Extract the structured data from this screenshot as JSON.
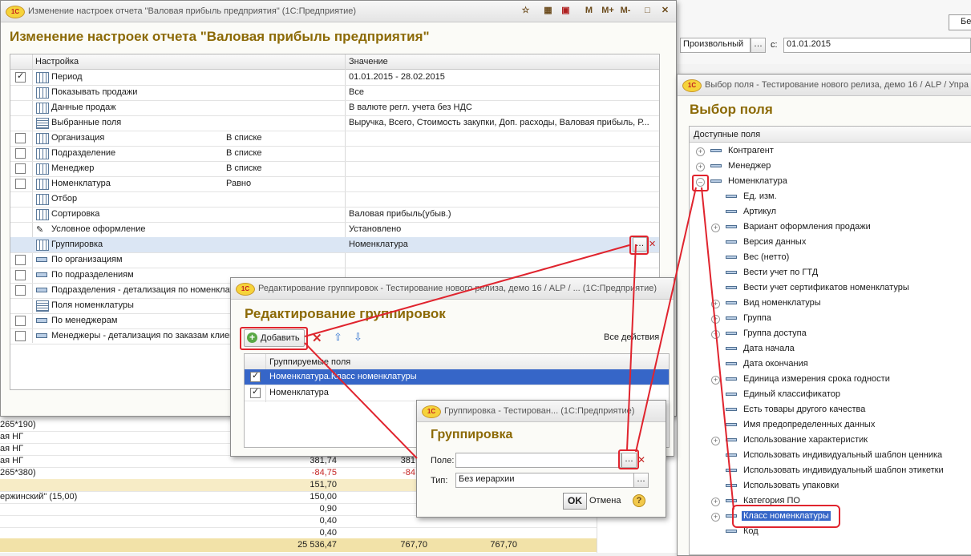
{
  "bg": {
    "period_type": "Произвольный",
    "date_from_label": "с:",
    "date_from": "01.01.2015",
    "corner_btn": "Бе",
    "rows": [
      {
        "a": "265*190)",
        "b": "",
        "c": ""
      },
      {
        "a": "ая НГ",
        "b": "",
        "c": ""
      },
      {
        "a": "ая НГ",
        "b": "",
        "c": ""
      },
      {
        "a": "ая НГ",
        "b": "381,74",
        "c": "381"
      },
      {
        "a": "265*380)",
        "b": "-84,75",
        "c": "-84"
      },
      {
        "a": "",
        "b": "151,70",
        "c": ""
      },
      {
        "a": "ержинский\" (15,00)",
        "b": "150,00",
        "c": ""
      },
      {
        "a": "",
        "b": "0,90",
        "c": ""
      },
      {
        "a": "",
        "b": "0,40",
        "c": ""
      },
      {
        "a": "",
        "b": "0,40",
        "c": ""
      }
    ],
    "totals": [
      "25 536,47",
      "767,70",
      "767,70"
    ]
  },
  "settings_win": {
    "title": "Изменение настроек отчета \"Валовая прибыль предприятия\" (1С:Предприятие)",
    "heading": "Изменение настроек отчета \"Валовая прибыль предприятия\"",
    "col_setting": "Настройка",
    "col_value": "Значение",
    "rows": [
      {
        "name": "Период",
        "value": "01.01.2015 - 28.02.2015",
        "kind": "",
        "cb": true,
        "icon": "tbl"
      },
      {
        "name": "Показывать продажи",
        "value": "Все",
        "kind": "",
        "cb": null,
        "icon": "tbl"
      },
      {
        "name": "Данные продаж",
        "value": "В валюте регл. учета без НДС",
        "kind": "",
        "cb": null,
        "icon": "tbl"
      },
      {
        "name": "Выбранные поля",
        "value": "Выручка, Всего, Стоимость закупки, Доп. расходы, Валовая прибыль, Р...",
        "kind": "",
        "cb": null,
        "icon": "list"
      },
      {
        "name": "Организация",
        "value": "",
        "kind": "В списке",
        "cb": false,
        "icon": "tbl"
      },
      {
        "name": "Подразделение",
        "value": "",
        "kind": "В списке",
        "cb": false,
        "icon": "tbl"
      },
      {
        "name": "Менеджер",
        "value": "",
        "kind": "В списке",
        "cb": false,
        "icon": "tbl"
      },
      {
        "name": "Номенклатура",
        "value": "",
        "kind": "Равно",
        "cb": false,
        "icon": "tbl"
      },
      {
        "name": "Отбор",
        "value": "",
        "kind": "",
        "cb": null,
        "icon": "tbl"
      },
      {
        "name": "Сортировка",
        "value": "Валовая прибыль(убыв.)",
        "kind": "",
        "cb": null,
        "icon": "tbl"
      },
      {
        "name": "Условное оформление",
        "value": "Установлено",
        "kind": "",
        "cb": null,
        "icon": "pen"
      },
      {
        "name": "Группировка",
        "value": "Номенклатура",
        "kind": "",
        "cb": null,
        "icon": "tbl",
        "selected": true
      },
      {
        "name": "По организациям",
        "value": "",
        "kind": "",
        "cb": false,
        "icon": "dash"
      },
      {
        "name": "По подразделениям",
        "value": "",
        "kind": "",
        "cb": false,
        "icon": "dash"
      },
      {
        "name": "Подразделения - детализация по номенклатуре",
        "value": "",
        "kind": "",
        "cb": false,
        "icon": "dash"
      },
      {
        "name": "Поля номенклатуры",
        "value": "",
        "kind": "",
        "cb": null,
        "icon": "list"
      },
      {
        "name": "По менеджерам",
        "value": "",
        "kind": "",
        "cb": false,
        "icon": "dash"
      },
      {
        "name": "Менеджеры - детализация по заказам клиентов",
        "value": "",
        "kind": "",
        "cb": false,
        "icon": "dash"
      }
    ],
    "tb_icons": [
      "star-icon",
      "calc-icon",
      "calendar-icon"
    ],
    "tb_text": [
      "M",
      "M+",
      "M-"
    ]
  },
  "group_edit_win": {
    "title": "Редактирование группировок - Тестирование нового релиза, демо 16 / ALP / ...  (1С:Предприятие)",
    "heading": "Редактирование группировок",
    "add_btn": "Добавить",
    "all_actions": "Все действия",
    "col": "Группируемые поля",
    "rows": [
      {
        "name": "Номенклатура.Класс номенклатуры",
        "checked": true,
        "selected": true
      },
      {
        "name": "Номенклатура",
        "checked": true,
        "selected": false
      }
    ]
  },
  "grouping_win": {
    "title": "Группировка - Тестирован...  (1С:Предприятие)",
    "heading": "Группировка",
    "field_label": "Поле:",
    "field_value": "",
    "type_label": "Тип:",
    "type_value": "Без иерархии",
    "ok": "OK",
    "cancel": "Отмена",
    "help": "?"
  },
  "field_win": {
    "title": "Выбор поля - Тестирование нового релиза, демо 16 / ALP / Упра",
    "heading": "Выбор поля",
    "col": "Доступные поля",
    "nodes": [
      {
        "name": "Контрагент",
        "level": 0,
        "exp": "+"
      },
      {
        "name": "Менеджер",
        "level": 0,
        "exp": "+"
      },
      {
        "name": "Номенклатура",
        "level": 0,
        "exp": "-"
      },
      {
        "name": "Ед. изм.",
        "level": 1,
        "exp": ""
      },
      {
        "name": "Артикул",
        "level": 1,
        "exp": ""
      },
      {
        "name": "Вариант оформления продажи",
        "level": 1,
        "exp": "+"
      },
      {
        "name": "Версия данных",
        "level": 1,
        "exp": ""
      },
      {
        "name": "Вес (нетто)",
        "level": 1,
        "exp": ""
      },
      {
        "name": "Вести учет по ГТД",
        "level": 1,
        "exp": ""
      },
      {
        "name": "Вести учет сертификатов номенклатуры",
        "level": 1,
        "exp": ""
      },
      {
        "name": "Вид номенклатуры",
        "level": 1,
        "exp": "+"
      },
      {
        "name": "Группа",
        "level": 1,
        "exp": "+"
      },
      {
        "name": "Группа доступа",
        "level": 1,
        "exp": "+"
      },
      {
        "name": "Дата начала",
        "level": 1,
        "exp": ""
      },
      {
        "name": "Дата окончания",
        "level": 1,
        "exp": ""
      },
      {
        "name": "Единица измерения срока годности",
        "level": 1,
        "exp": "+"
      },
      {
        "name": "Единый классификатор",
        "level": 1,
        "exp": ""
      },
      {
        "name": "Есть товары другого качества",
        "level": 1,
        "exp": ""
      },
      {
        "name": "Имя предопределенных данных",
        "level": 1,
        "exp": ""
      },
      {
        "name": "Использование характеристик",
        "level": 1,
        "exp": "+"
      },
      {
        "name": "Использовать индивидуальный шаблон ценника",
        "level": 1,
        "exp": ""
      },
      {
        "name": "Использовать индивидуальный шаблон этикетки",
        "level": 1,
        "exp": ""
      },
      {
        "name": "Использовать упаковки",
        "level": 1,
        "exp": ""
      },
      {
        "name": "Категория ПО",
        "level": 1,
        "exp": "+"
      },
      {
        "name": "Класс номенклатуры",
        "level": 1,
        "exp": "+",
        "selected": true
      },
      {
        "name": "Код",
        "level": 1,
        "exp": ""
      }
    ]
  },
  "colors": {
    "accent": "#8c6a06",
    "highlight": "#e0242e",
    "selection": "#3666c8"
  }
}
